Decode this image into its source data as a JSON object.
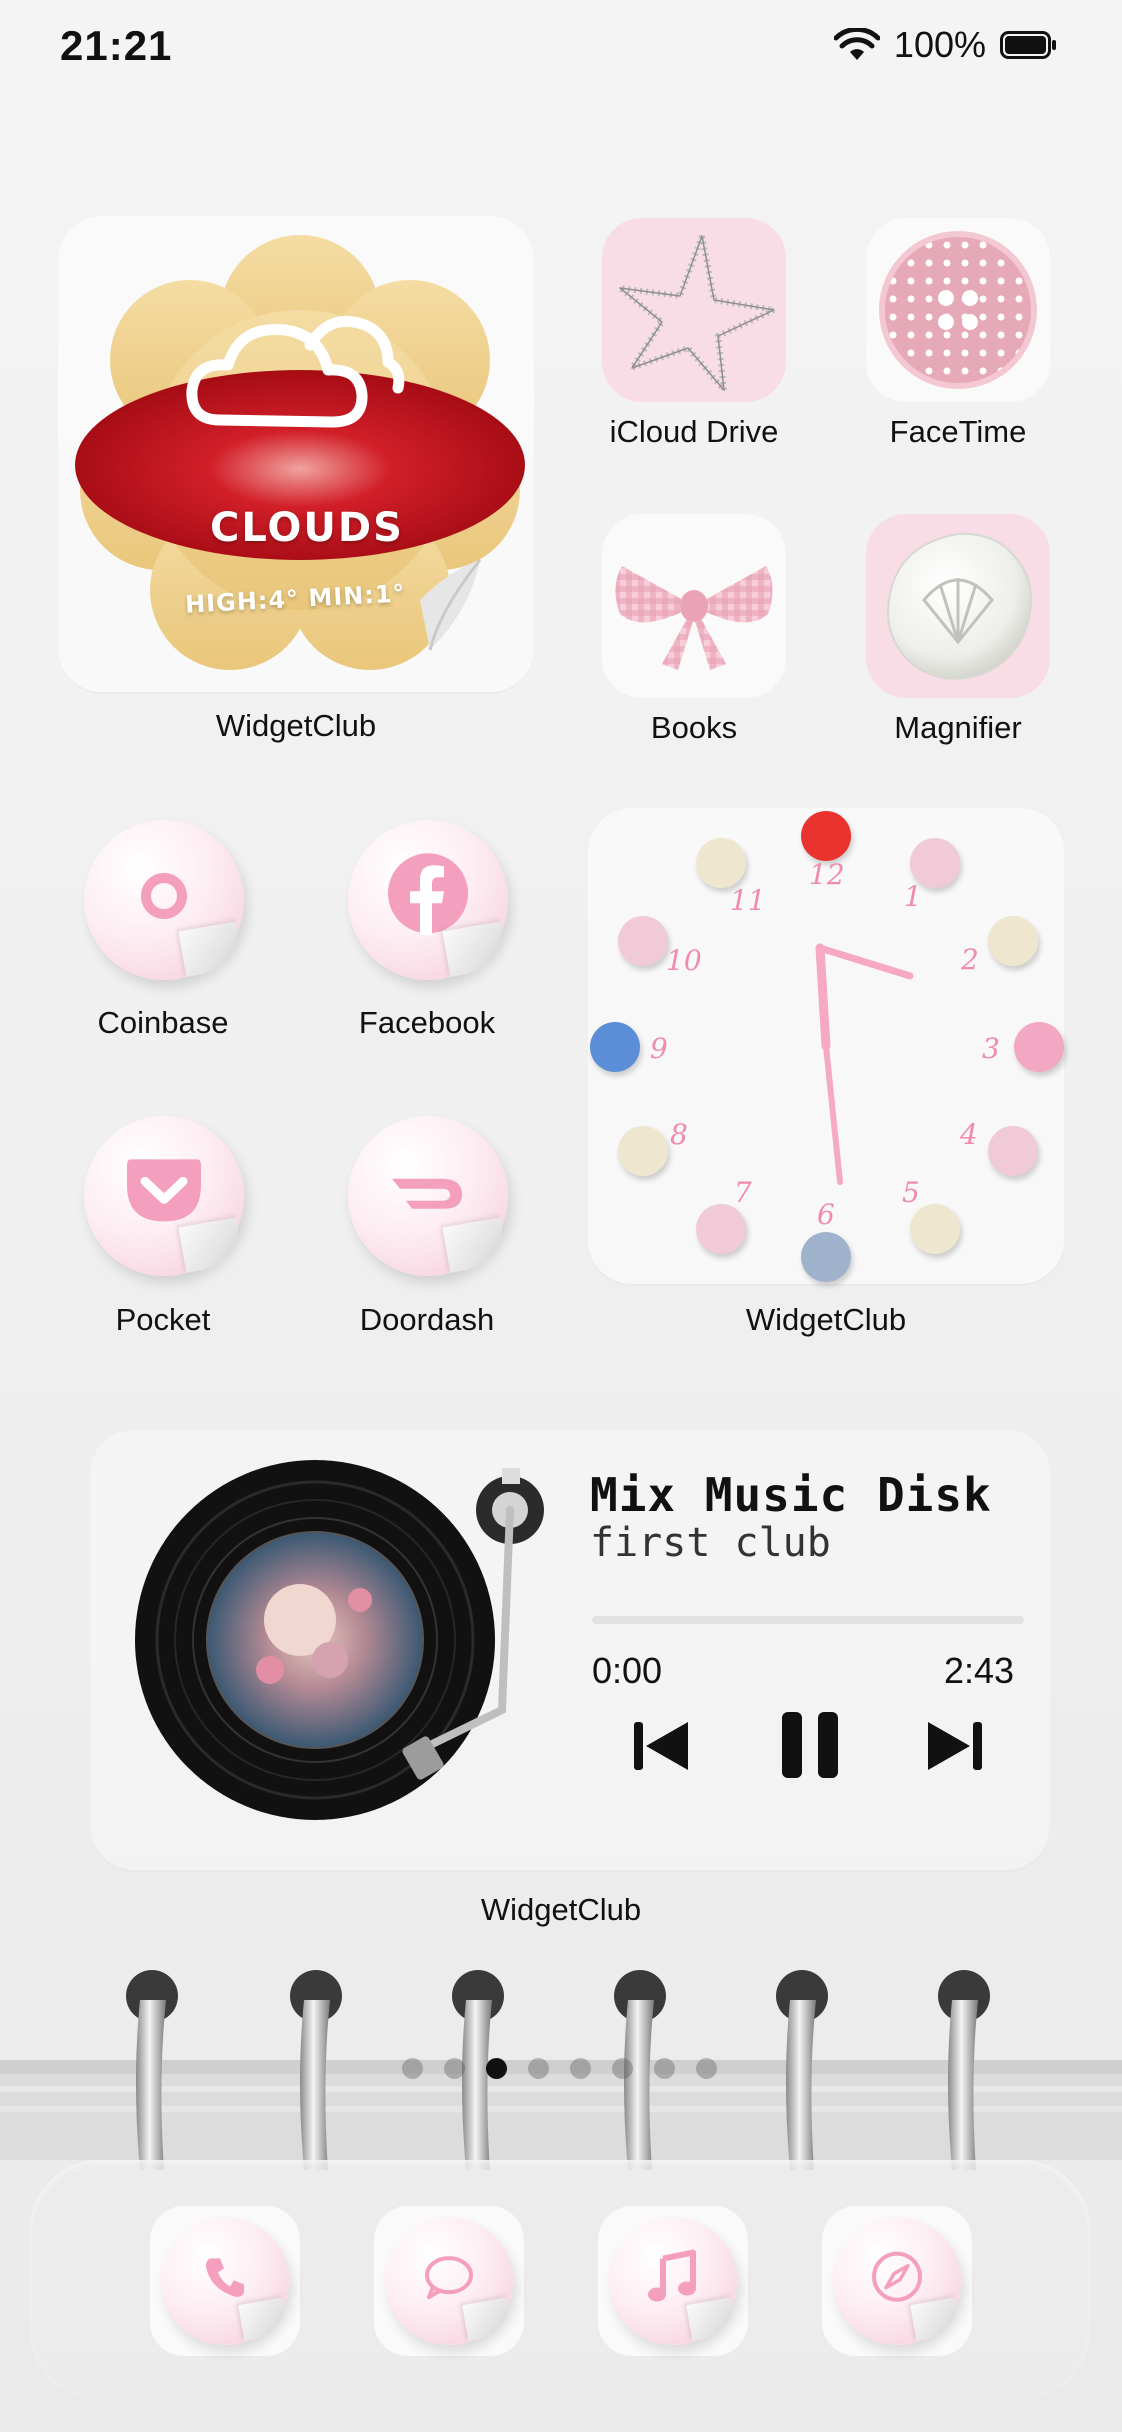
{
  "status_bar": {
    "time": "21:21",
    "battery": "100%"
  },
  "widgets": {
    "weather": {
      "title": "CLOUDS",
      "sub": "HIGH:4° MIN:1°",
      "label": "WidgetClub"
    },
    "clock": {
      "label": "WidgetClub",
      "numbers": [
        "12",
        "1",
        "2",
        "3",
        "4",
        "5",
        "6",
        "7",
        "8",
        "9",
        "10",
        "11"
      ]
    },
    "music": {
      "title": "Mix Music Disk",
      "subtitle": "first club",
      "current_time": "0:00",
      "duration": "2:43",
      "progress": 0,
      "label": "WidgetClub"
    }
  },
  "apps": {
    "icloud_drive": "iCloud Drive",
    "facetime": "FaceTime",
    "books": "Books",
    "magnifier": "Magnifier",
    "coinbase": "Coinbase",
    "facebook": "Facebook",
    "pocket": "Pocket",
    "doordash": "Doordash"
  },
  "page_indicator": {
    "count": 8,
    "active": 3
  },
  "dock": [
    "phone-icon",
    "messages-icon",
    "music-icon",
    "safari-icon"
  ],
  "colors": {
    "accent_pink": "#f08ab0",
    "clock_red": "#e8332f",
    "clock_blue": "#5b8ed6"
  }
}
